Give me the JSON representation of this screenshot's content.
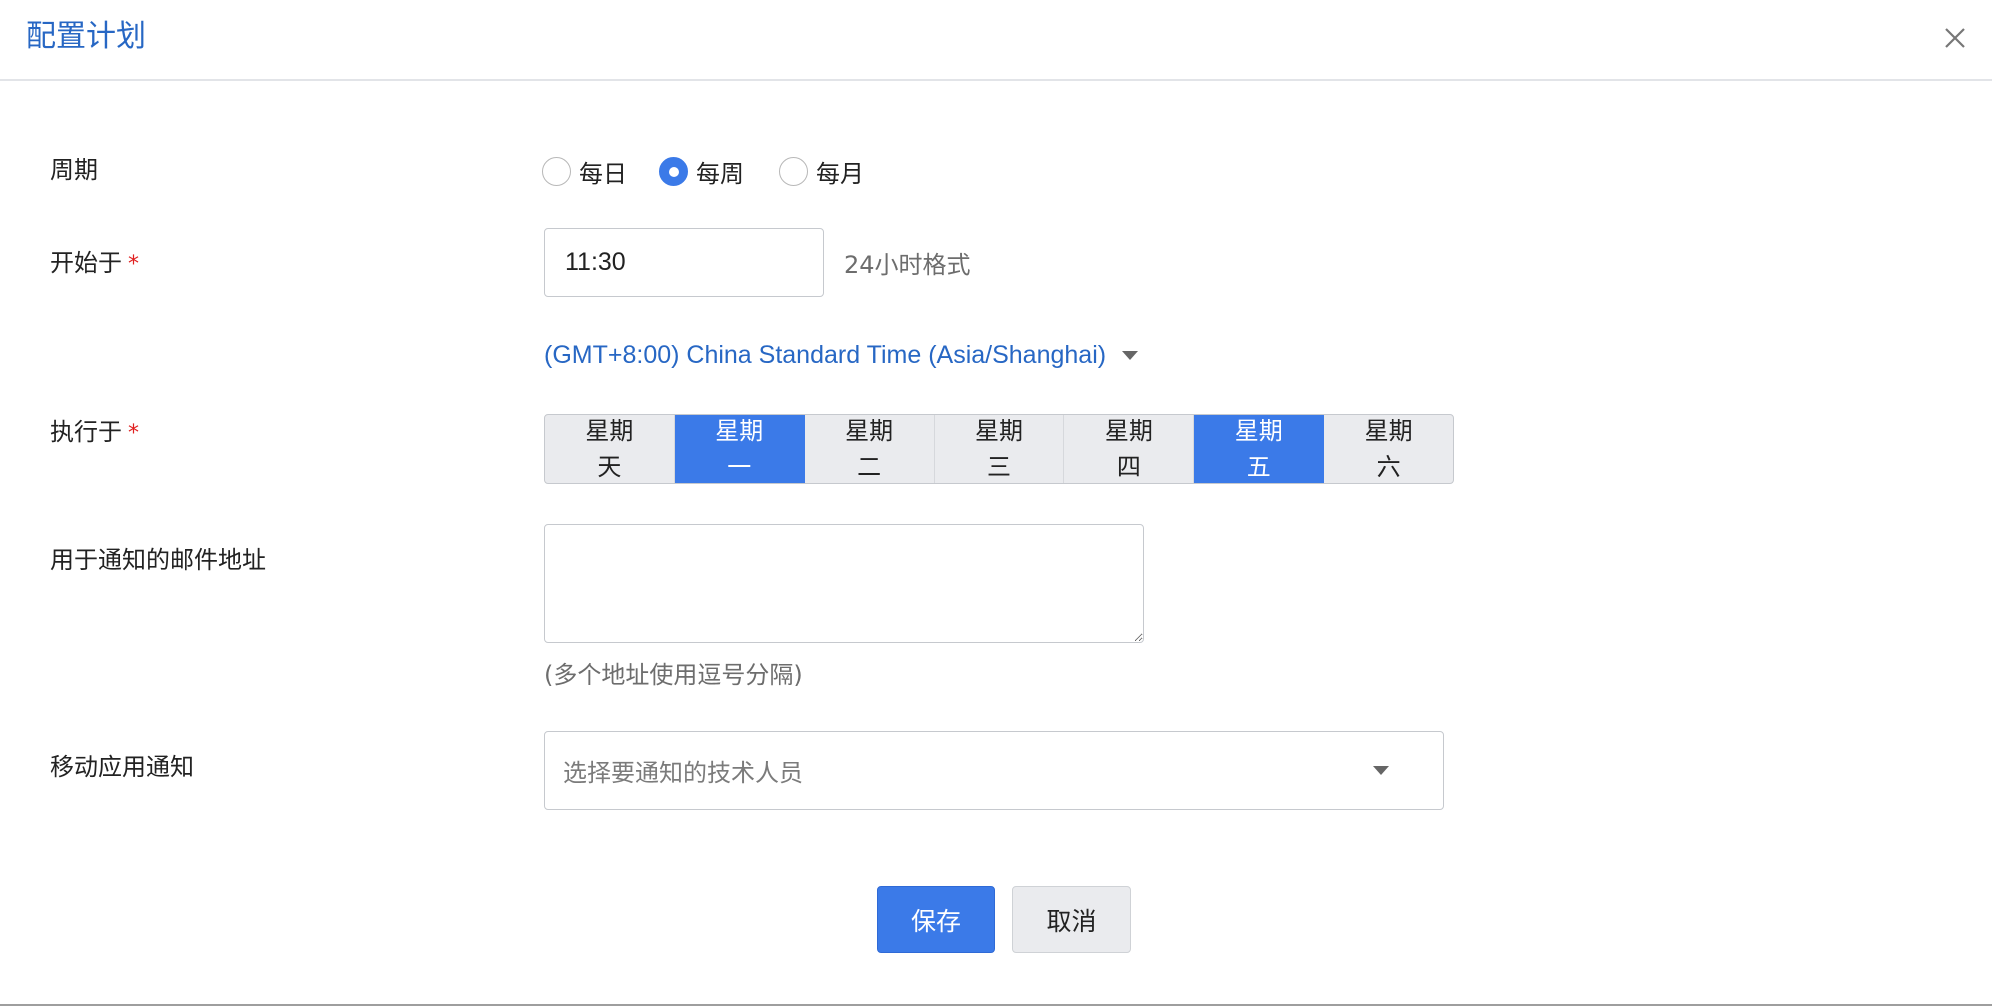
{
  "dialog": {
    "title": "配置计划"
  },
  "period": {
    "label": "周期",
    "options": [
      {
        "label": "每日",
        "checked": false
      },
      {
        "label": "每周",
        "checked": true
      },
      {
        "label": "每月",
        "checked": false
      }
    ]
  },
  "start": {
    "label": "开始于",
    "required_mark": "*",
    "value": "11:30",
    "hint": "24小时格式",
    "timezone": "(GMT+8:00) China Standard Time (Asia/Shanghai)"
  },
  "execute": {
    "label": "执行于",
    "required_mark": "*",
    "days": [
      {
        "line1": "星期",
        "line2": "天",
        "selected": false
      },
      {
        "line1": "星期",
        "line2": "一",
        "selected": true
      },
      {
        "line1": "星期",
        "line2": "二",
        "selected": false
      },
      {
        "line1": "星期",
        "line2": "三",
        "selected": false
      },
      {
        "line1": "星期",
        "line2": "四",
        "selected": false
      },
      {
        "line1": "星期",
        "line2": "五",
        "selected": true
      },
      {
        "line1": "星期",
        "line2": "六",
        "selected": false
      }
    ]
  },
  "email": {
    "label": "用于通知的邮件地址",
    "value": "",
    "hint": "(多个地址使用逗号分隔)"
  },
  "mobile": {
    "label": "移动应用通知",
    "placeholder": "选择要通知的技术人员"
  },
  "actions": {
    "save_label": "保存",
    "cancel_label": "取消"
  },
  "colors": {
    "accent": "#3b7ae8",
    "title": "#2767c4",
    "required": "#e02020"
  }
}
